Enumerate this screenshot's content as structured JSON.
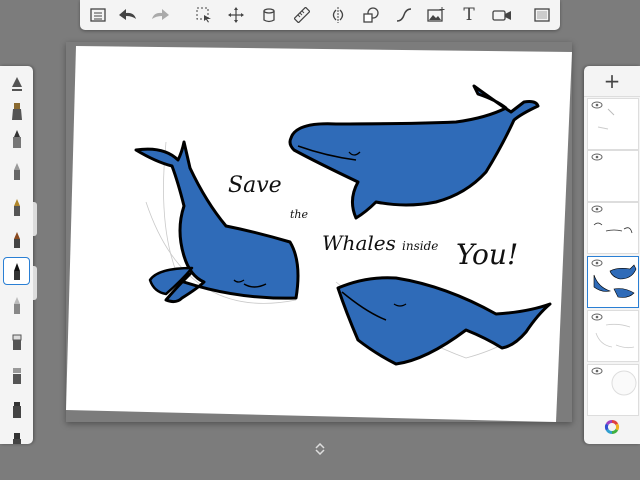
{
  "app": {
    "accent_color": "#2a7fd4",
    "whale_color": "#2f6bb8"
  },
  "toolbar": {
    "items": [
      {
        "icon": "list-icon",
        "name": "menu-button"
      },
      {
        "icon": "undo-icon",
        "name": "undo-button"
      },
      {
        "icon": "redo-icon",
        "name": "redo-button"
      },
      {
        "icon": "selection-icon",
        "name": "selection-tool-button"
      },
      {
        "icon": "transform-icon",
        "name": "transform-tool-button"
      },
      {
        "icon": "fill-icon",
        "name": "fill-tool-button"
      },
      {
        "icon": "ruler-icon",
        "name": "ruler-tool-button"
      },
      {
        "icon": "symmetry-icon",
        "name": "symmetry-tool-button"
      },
      {
        "icon": "shapes-icon",
        "name": "shapes-tool-button"
      },
      {
        "icon": "curve-icon",
        "name": "curve-tool-button"
      },
      {
        "icon": "image-icon",
        "name": "import-image-button"
      },
      {
        "icon": "text-icon",
        "name": "text-tool-button",
        "label": "T"
      },
      {
        "icon": "video-icon",
        "name": "time-lapse-button"
      },
      {
        "icon": "fullscreen-icon",
        "name": "fullscreen-button"
      }
    ]
  },
  "canvas": {
    "text_save": "Save",
    "text_the": "the",
    "text_whales": "Whales",
    "text_inside": "inside",
    "text_you": "You!"
  },
  "brushes": [
    {
      "name": "brush-airbrush"
    },
    {
      "name": "brush-marker"
    },
    {
      "name": "brush-felt-pen"
    },
    {
      "name": "brush-paint"
    },
    {
      "name": "brush-fountain-pen"
    },
    {
      "name": "brush-ink-pen"
    },
    {
      "name": "brush-ballpoint-pen",
      "selected": true
    },
    {
      "name": "brush-pencil"
    },
    {
      "name": "brush-eraser"
    },
    {
      "name": "brush-smudge"
    },
    {
      "name": "brush-chisel"
    },
    {
      "name": "brush-extra"
    }
  ],
  "layers": {
    "add_label": "+",
    "items": [
      {
        "name": "layer-1"
      },
      {
        "name": "layer-2"
      },
      {
        "name": "layer-3-text"
      },
      {
        "name": "layer-4-whales",
        "selected": true
      },
      {
        "name": "layer-5-sketch"
      },
      {
        "name": "layer-6-background"
      }
    ]
  }
}
